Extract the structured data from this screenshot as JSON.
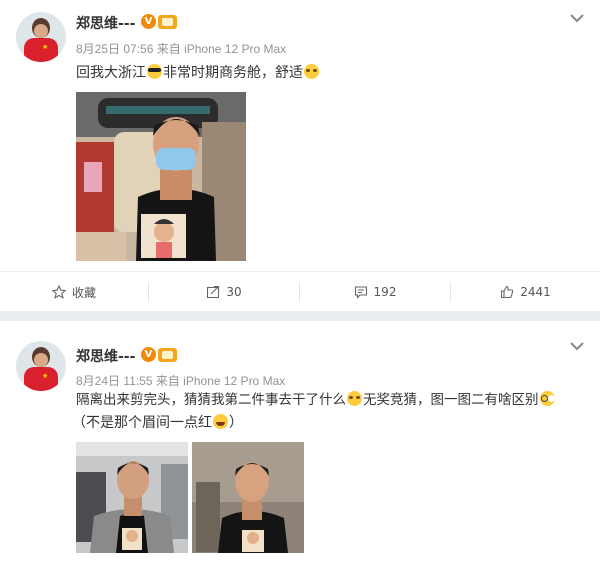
{
  "posts": [
    {
      "author": "郑思维---",
      "verified_mark": "V",
      "time": "8月25日 07:56",
      "source": "来自 iPhone 12 Pro Max",
      "text_segments": [
        "回我大浙江",
        "非常时期商务舱，舒适"
      ],
      "actions": {
        "favorite": "收藏",
        "repost": "30",
        "comment": "192",
        "like": "2441"
      }
    },
    {
      "author": "郑思维---",
      "verified_mark": "V",
      "time": "8月24日 11:55",
      "source": "来自 iPhone 12 Pro Max",
      "text_line1_segments": [
        "隔离出来剪完头，猜猜我第二件事去干了什么",
        "无奖竞猜，图一图二有啥区别"
      ],
      "text_line2_segments": [
        "（不是那个眉间一点红",
        "）"
      ]
    }
  ],
  "icons": [
    "chevron-down-icon",
    "star-icon",
    "repost-icon",
    "comment-icon",
    "like-icon",
    "verified-badge-icon",
    "level-badge-icon"
  ],
  "colors": {
    "accent": "#f08a0c",
    "text": "#333333",
    "meta": "#939393",
    "background": "#eaeef2"
  }
}
